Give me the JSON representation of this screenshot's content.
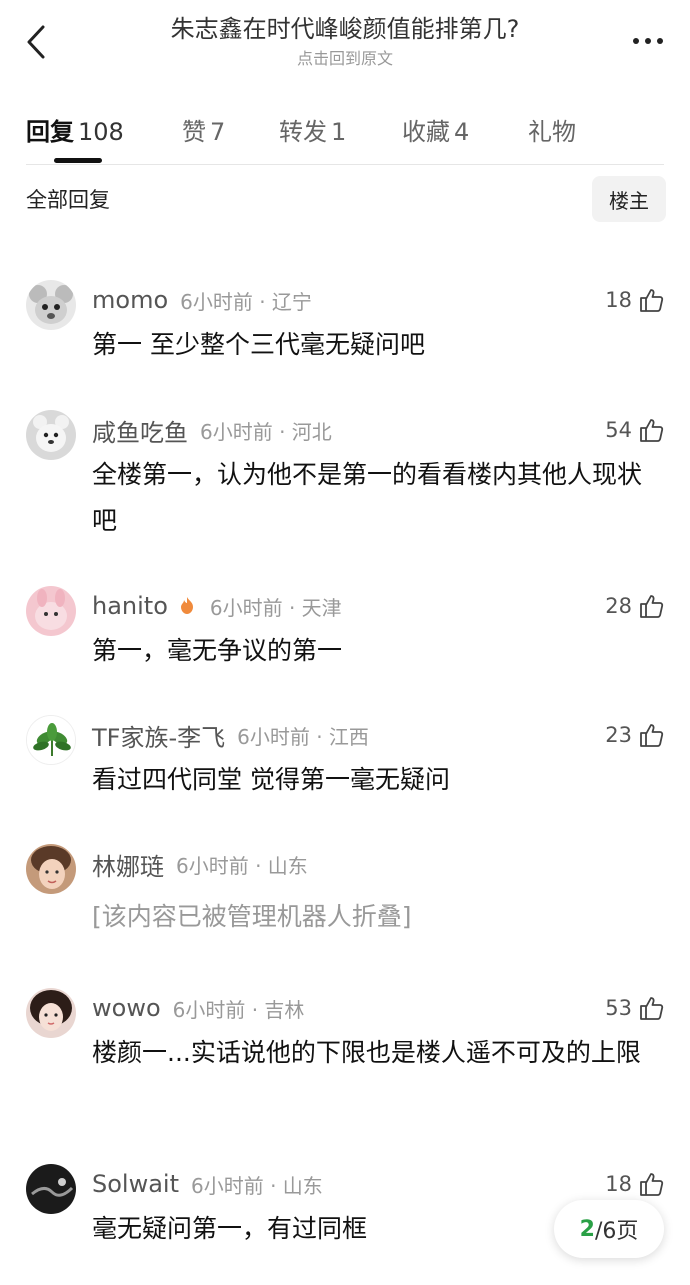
{
  "header": {
    "title": "朱志鑫在时代峰峻颜值能排第几?",
    "subtitle": "点击回到原文"
  },
  "tabs": [
    {
      "label": "回复",
      "count": "108"
    },
    {
      "label": "赞",
      "count": "7"
    },
    {
      "label": "转发",
      "count": "1"
    },
    {
      "label": "收藏",
      "count": "4"
    },
    {
      "label": "礼物",
      "count": ""
    }
  ],
  "filter": {
    "label": "全部回复",
    "owner_button": "楼主"
  },
  "comments": [
    {
      "user": "momo",
      "time": "6小时前 · 辽宁",
      "likes": "18",
      "text": "第一 至少整个三代毫无疑问吧",
      "avatar": "mouse-avatar"
    },
    {
      "user": "咸鱼吃鱼",
      "time": "6小时前 · 河北",
      "likes": "54",
      "text": "全楼第一，认为他不是第一的看看楼内其他人现状吧",
      "avatar": "bear-avatar"
    },
    {
      "user": "hanito",
      "time": "6小时前 · 天津",
      "likes": "28",
      "text": "第一，毫无争议的第一",
      "avatar": "pink-avatar"
    },
    {
      "user": "TF家族-李飞",
      "time": "6小时前 · 江西",
      "likes": "23",
      "text": "看过四代同堂 觉得第一毫无疑问",
      "avatar": "leaf-avatar"
    },
    {
      "user": "林娜琏",
      "time": "6小时前 · 山东",
      "likes": "",
      "text": "[该内容已被管理机器人折叠]",
      "avatar": "girl-avatar"
    },
    {
      "user": "wowo",
      "time": "6小时前 · 吉林",
      "likes": "53",
      "text": "楼颜一...实话说他的下限也是楼人遥不可及的上限",
      "avatar": "girl2-avatar"
    },
    {
      "user": "Solwait",
      "time": "6小时前 · 山东",
      "likes": "18",
      "text": "毫无疑问第一，有过同框",
      "avatar": "dark-avatar"
    }
  ],
  "pager": {
    "current": "2",
    "total": "/6页"
  },
  "colors": {
    "accent_green": "#2aa046",
    "folded_text": "#999999"
  }
}
